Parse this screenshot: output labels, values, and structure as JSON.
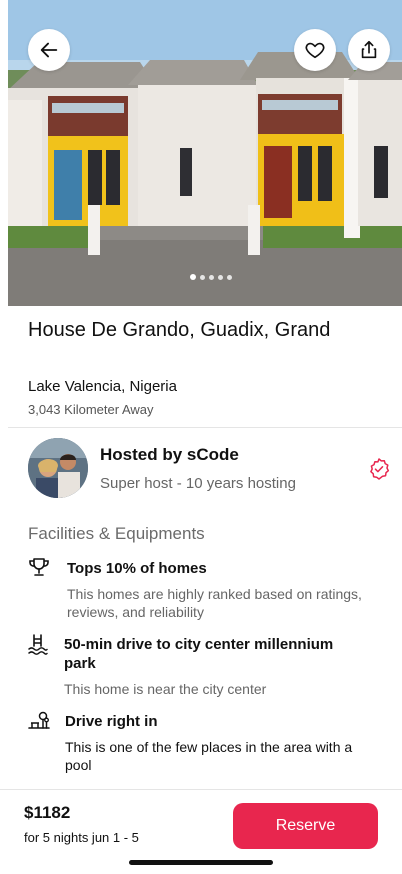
{
  "listing": {
    "title": "House De Grando, Guadix, Grand",
    "location": "Lake Valencia, Nigeria",
    "distance": "3,043 Kilometer Away"
  },
  "hero": {
    "icons": {
      "back": "arrow-left-icon",
      "favorite": "heart-icon",
      "share": "share-icon"
    },
    "carousel": {
      "total": 5,
      "active_index": 0
    }
  },
  "host": {
    "name": "Hosted by sCode",
    "subtitle": "Super host - 10 years hosting",
    "badge_icon": "verified-badge-icon"
  },
  "facilities": {
    "heading": "Facilities & Equipments",
    "items": [
      {
        "icon": "trophy-icon",
        "title": "Tops 10% of homes",
        "description": "This homes are highly ranked based on ratings, reviews, and reliability"
      },
      {
        "icon": "pool-icon",
        "title": "50-min drive to city center millennium park",
        "description": "This home is near the city center"
      },
      {
        "icon": "park-icon",
        "title": "Drive right in",
        "description": "This is one of the few places in the area with a pool"
      }
    ]
  },
  "booking": {
    "price": "$1182",
    "nights": "for 5 nights jun 1 - 5",
    "reserve_label": "Reserve"
  },
  "colors": {
    "accent": "#e8264e",
    "text": "#111111",
    "muted": "#666666"
  }
}
